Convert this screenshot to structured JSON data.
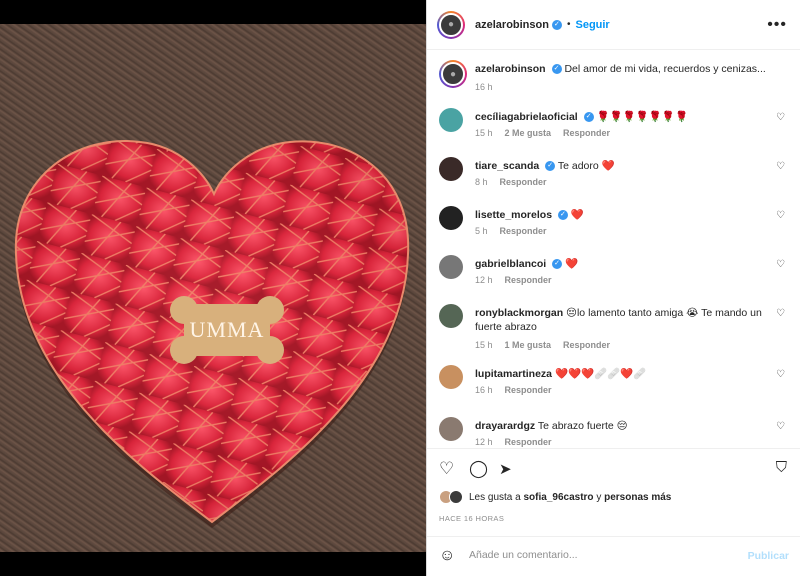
{
  "post": {
    "username": "azelarobinson",
    "follow_label": "Seguir",
    "more_icon": "more-options-icon",
    "caption_user": "azelarobinson",
    "caption_text": "Del amor de mi vida, recuerdos y cenizas...",
    "caption_time": "16 h",
    "image_label": "UMMA"
  },
  "comments": [
    {
      "user": "cecíliagabrielaoficial",
      "verified": true,
      "text": "🌹🌹🌹🌹🌹🌹🌹",
      "time": "15 h",
      "likes": "2 Me gusta",
      "reply": "Responder",
      "avatar_color": "#4aa3a3"
    },
    {
      "user": "tiare_scanda",
      "verified": true,
      "text": "Te adoro ❤️",
      "time": "8 h",
      "likes": "",
      "reply": "Responder",
      "avatar_color": "#3a2a28"
    },
    {
      "user": "lisette_morelos",
      "verified": true,
      "text": "❤️",
      "time": "5 h",
      "likes": "",
      "reply": "Responder",
      "avatar_color": "#222222"
    },
    {
      "user": "gabrielblancoi",
      "verified": true,
      "text": "❤️",
      "time": "12 h",
      "likes": "",
      "reply": "Responder",
      "avatar_color": "#777777"
    },
    {
      "user": "ronyblackmorgan",
      "verified": false,
      "text": "😔lo lamento tanto amiga 😭 Te mando un fuerte abrazo",
      "time": "15 h",
      "likes": "1 Me gusta",
      "reply": "Responder",
      "avatar_color": "#556655"
    },
    {
      "user": "lupitamartineza",
      "verified": false,
      "text": "❤️❤️❤️🩹🩹❤️🩹",
      "time": "16 h",
      "likes": "",
      "reply": "Responder",
      "avatar_color": "#c89060"
    },
    {
      "user": "drayarardgz",
      "verified": false,
      "text": "Te abrazo fuerte 😔",
      "time": "12 h",
      "likes": "",
      "reply": "Responder",
      "avatar_color": "#8a7a70"
    }
  ],
  "likes": {
    "prefix": "Les gusta a",
    "user": "sofia_96castro",
    "connector": "y",
    "suffix": "personas más"
  },
  "timestamp": "HACE 16 HORAS",
  "composer": {
    "placeholder": "Añade un comentario...",
    "publish_label": "Publicar"
  },
  "colors": {
    "accent": "#0095f6",
    "verified": "#3897f0",
    "heart": "#e0342c"
  }
}
